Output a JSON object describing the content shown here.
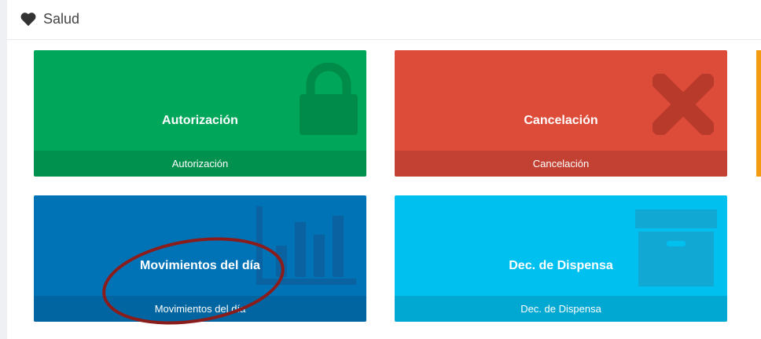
{
  "header": {
    "title": "Salud",
    "icon": "heart-icon"
  },
  "tiles": [
    {
      "title": "Autorización",
      "footer": "Autorización",
      "icon": "lock-icon",
      "color": "#00a65a"
    },
    {
      "title": "Cancelación",
      "footer": "Cancelación",
      "icon": "x-mark-icon",
      "color": "#dd4b39"
    },
    {
      "title": "Movimientos del día",
      "footer": "Movimientos del día",
      "icon": "bar-chart-icon",
      "color": "#0073b7"
    },
    {
      "title": "Dec. de Dispensa",
      "footer": "Dec. de Dispensa",
      "icon": "archive-box-icon",
      "color": "#00c0ef"
    }
  ],
  "annotation_color": "#8b1c1c"
}
